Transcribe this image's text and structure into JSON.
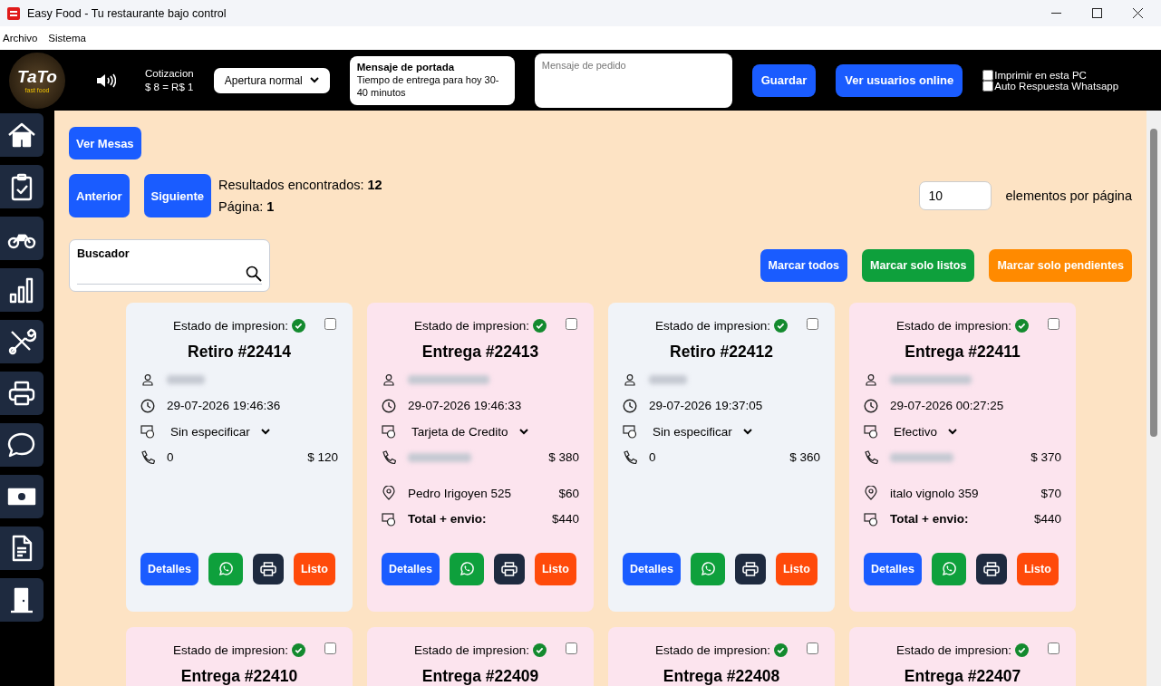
{
  "window": {
    "title": "Easy Food - Tu restaurante bajo control"
  },
  "menu": [
    "Archivo",
    "Sistema"
  ],
  "header": {
    "logo": "TaTo",
    "logo_sub": "fast food",
    "rate_label": "Cotizacion",
    "rate_value": "$ 8 = R$ 1",
    "opening": "Apertura normal",
    "cover_title": "Mensaje de portada",
    "cover_text": "Tiempo de entrega para hoy 30-40 minutos",
    "order_message_placeholder": "Mensaje de pedido",
    "save": "Guardar",
    "online": "Ver usuarios online",
    "options": [
      {
        "label": "Imprimir en esta PC",
        "checked": false
      },
      {
        "label": "Auto Respuesta Whatsapp",
        "checked": false
      }
    ]
  },
  "tables_button": "Ver Mesas",
  "pager": {
    "prev": "Anterior",
    "next": "Siguiente",
    "results_label": "Resultados encontrados:",
    "results": "12",
    "page_label": "Página:",
    "page": "1",
    "per_page": "10",
    "per_page_label": "elementos por página"
  },
  "search": {
    "label": "Buscador"
  },
  "mark_buttons": [
    {
      "label": "Marcar todos",
      "color": "#1a5cff"
    },
    {
      "label": "Marcar solo listos",
      "color": "#0ea03c"
    },
    {
      "label": "Marcar solo pendientes",
      "color": "#ff8a00"
    }
  ],
  "cards": [
    {
      "kind": "pickup",
      "print_label": "Estado de impresion:",
      "printed": true,
      "selected": false,
      "title": "Retiro #22414",
      "name_hidden": true,
      "date": "29-07-2026 19:46:36",
      "payment": "Sin especificar",
      "phone": "0",
      "phone_hidden": false,
      "amount": "$ 120",
      "buttons": {
        "details": "Detalles",
        "ready": "Listo"
      }
    },
    {
      "kind": "delivery",
      "print_label": "Estado de impresion:",
      "printed": true,
      "selected": false,
      "title": "Entrega #22413",
      "name_hidden": true,
      "date": "29-07-2026 19:46:33",
      "payment": "Tarjeta de Credito",
      "phone_hidden": true,
      "amount": "$ 380",
      "address": "Pedro Irigoyen 525",
      "shipping": "$60",
      "total_label": "Total + envio:",
      "total": "$440",
      "buttons": {
        "details": "Detalles",
        "ready": "Listo"
      }
    },
    {
      "kind": "pickup",
      "print_label": "Estado de impresion:",
      "printed": true,
      "selected": false,
      "title": "Retiro #22412",
      "name_hidden": true,
      "date": "29-07-2026 19:37:05",
      "payment": "Sin especificar",
      "phone": "0",
      "phone_hidden": false,
      "amount": "$ 360",
      "buttons": {
        "details": "Detalles",
        "ready": "Listo"
      }
    },
    {
      "kind": "delivery",
      "print_label": "Estado de impresion:",
      "printed": true,
      "selected": false,
      "title": "Entrega #22411",
      "name_hidden": true,
      "date": "29-07-2026 00:27:25",
      "payment": "Efectivo",
      "phone_hidden": true,
      "amount": "$ 370",
      "address": "italo vignolo 359",
      "shipping": "$70",
      "total_label": "Total + envio:",
      "total": "$440",
      "buttons": {
        "details": "Detalles",
        "ready": "Listo"
      }
    },
    {
      "kind": "delivery",
      "print_label": "Estado de impresion:",
      "printed": true,
      "selected": false,
      "title": "Entrega #22410"
    },
    {
      "kind": "delivery",
      "print_label": "Estado de impresion:",
      "printed": true,
      "selected": false,
      "title": "Entrega #22409"
    },
    {
      "kind": "delivery",
      "print_label": "Estado de impresion:",
      "printed": true,
      "selected": false,
      "title": "Entrega #22408"
    },
    {
      "kind": "delivery",
      "print_label": "Estado de impresion:",
      "printed": true,
      "selected": false,
      "title": "Entrega #22407"
    }
  ]
}
